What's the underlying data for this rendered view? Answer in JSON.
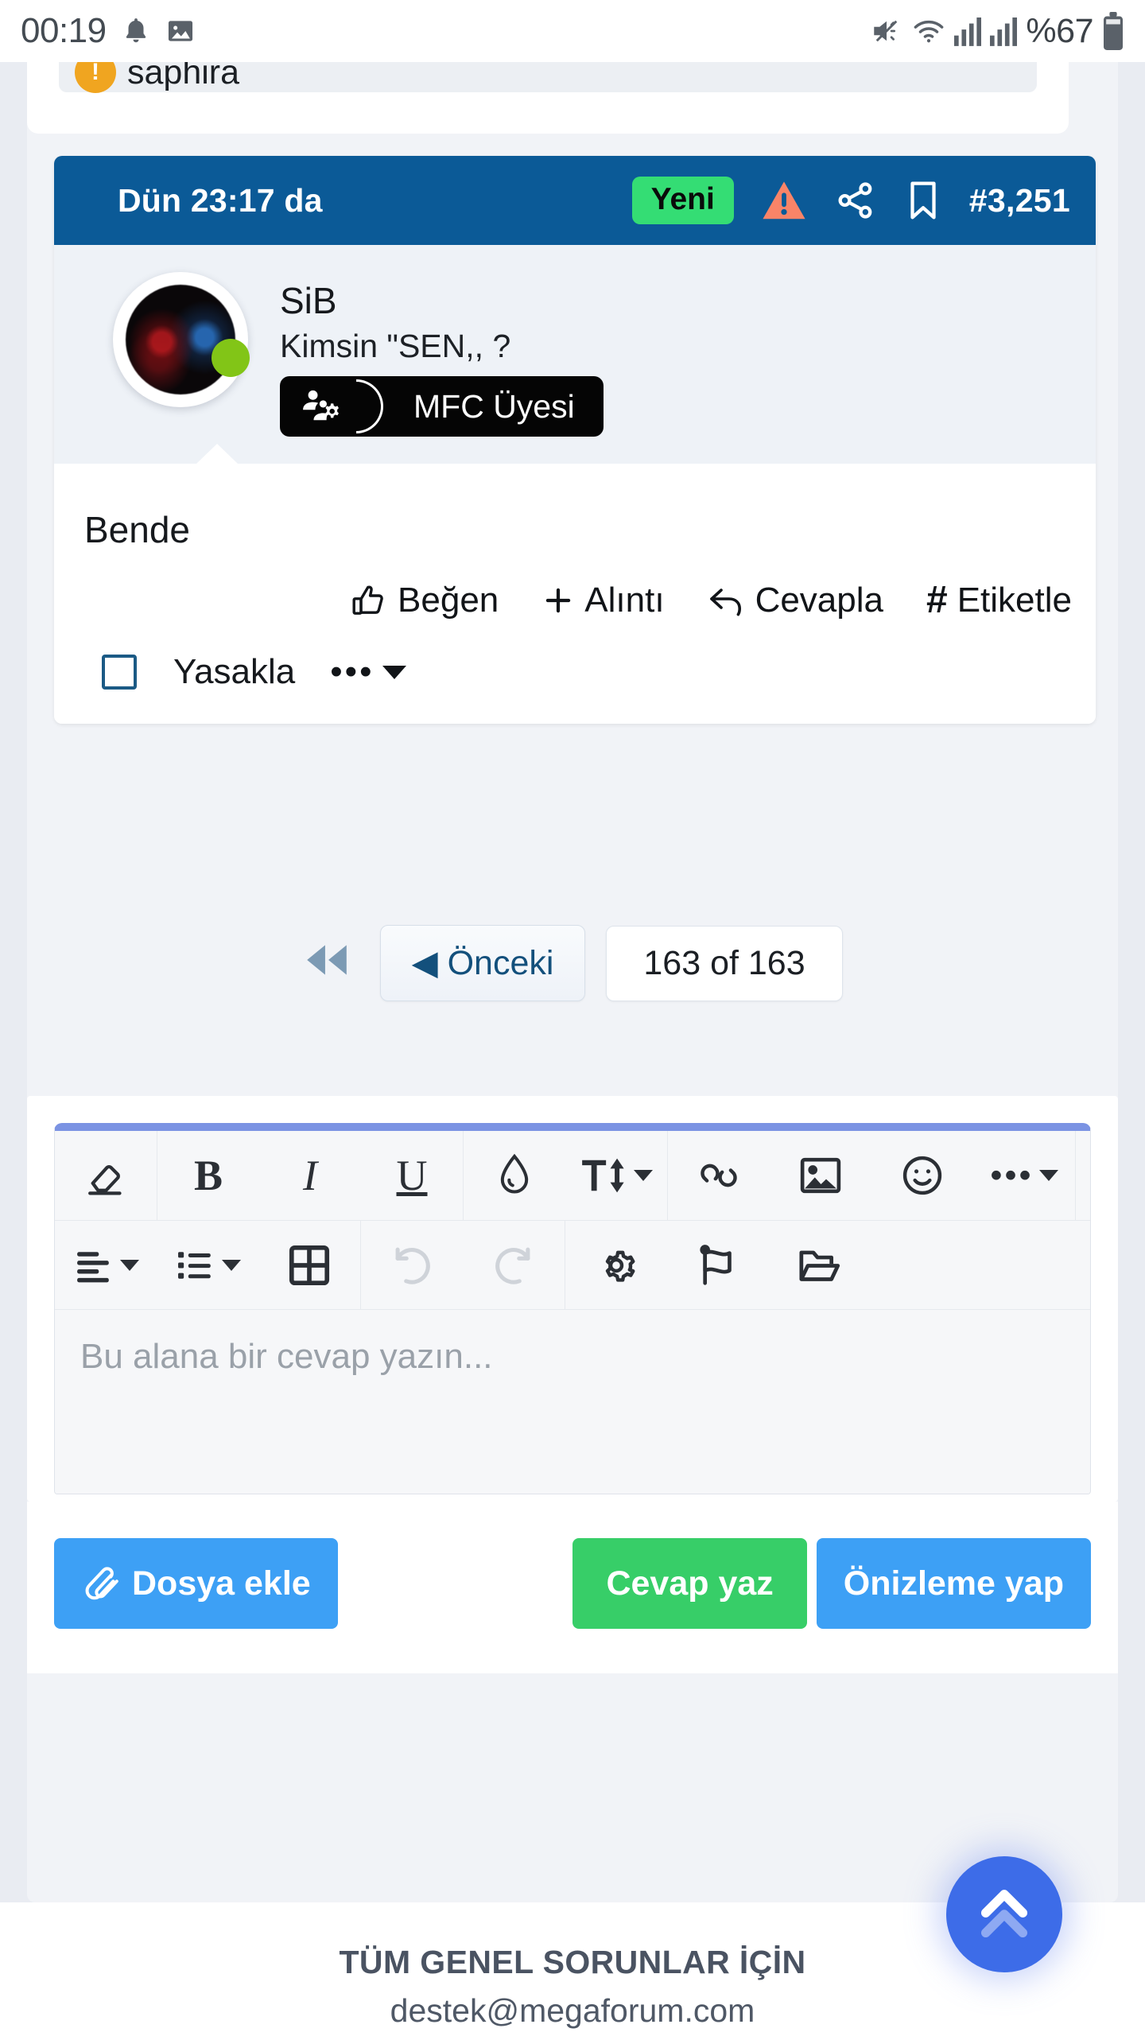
{
  "statusbar": {
    "time": "00:19",
    "battery_pct": "%67",
    "icons": [
      "bell-icon",
      "image-icon",
      "mute-icon",
      "wifi-icon",
      "signal-icon",
      "signal-icon",
      "battery-icon"
    ]
  },
  "previous_post": {
    "author": "saphira",
    "avatar_initial": "!"
  },
  "post": {
    "date": "Dün 23:17 da",
    "badge_new": "Yeni",
    "number": "#3,251",
    "header_icons": [
      "warning-icon",
      "share-icon",
      "bookmark-icon"
    ],
    "user": {
      "name": "SiB",
      "tagline": "Kimsin \"SEN,, ?",
      "rank": "MFC Üyesi",
      "status": "online"
    },
    "body": "Bende",
    "actions": [
      {
        "label": "Beğen",
        "icon": "thumbs-up-icon"
      },
      {
        "label": "Alıntı",
        "icon": "plus-icon"
      },
      {
        "label": "Cevapla",
        "icon": "reply-arrow-icon"
      },
      {
        "label": "Etiketle",
        "icon": "hash-icon"
      }
    ],
    "moderation": {
      "checkbox_label": "Yasakla",
      "checked": false,
      "more_label": "•••"
    }
  },
  "pagination": {
    "first_label": "◀◀",
    "prev_label": "◀ Önceki",
    "count_label": "163 of 163"
  },
  "editor": {
    "placeholder": "Bu alana bir cevap yazın...",
    "value": "",
    "toolbar_row1": [
      "eraser-icon",
      "bold-icon",
      "italic-icon",
      "underline-icon",
      "text-color-icon",
      "font-size-icon",
      "link-icon",
      "image-icon",
      "emoji-icon",
      "more-icon"
    ],
    "toolbar_row2": [
      "align-icon",
      "list-icon",
      "table-icon",
      "undo-icon",
      "redo-icon",
      "gear-icon",
      "flag-icon",
      "folder-icon"
    ]
  },
  "buttons": {
    "attach": "Dosya ekle",
    "reply": "Cevap yaz",
    "preview": "Önizleme yap"
  },
  "footer": {
    "title": "TÜM GENEL SORUNLAR İÇİN",
    "email": "destek@megaforum.com"
  },
  "fab": {
    "name": "scroll-to-top"
  },
  "colors": {
    "header_blue": "#0b5a97",
    "badge_green": "#34dd74",
    "button_blue": "#3da0f5",
    "button_green": "#37ce68",
    "warning_orange": "#f98468",
    "online_green": "#82c517",
    "fab_blue": "#3d6ce8",
    "editor_accent": "#7b93e3"
  }
}
